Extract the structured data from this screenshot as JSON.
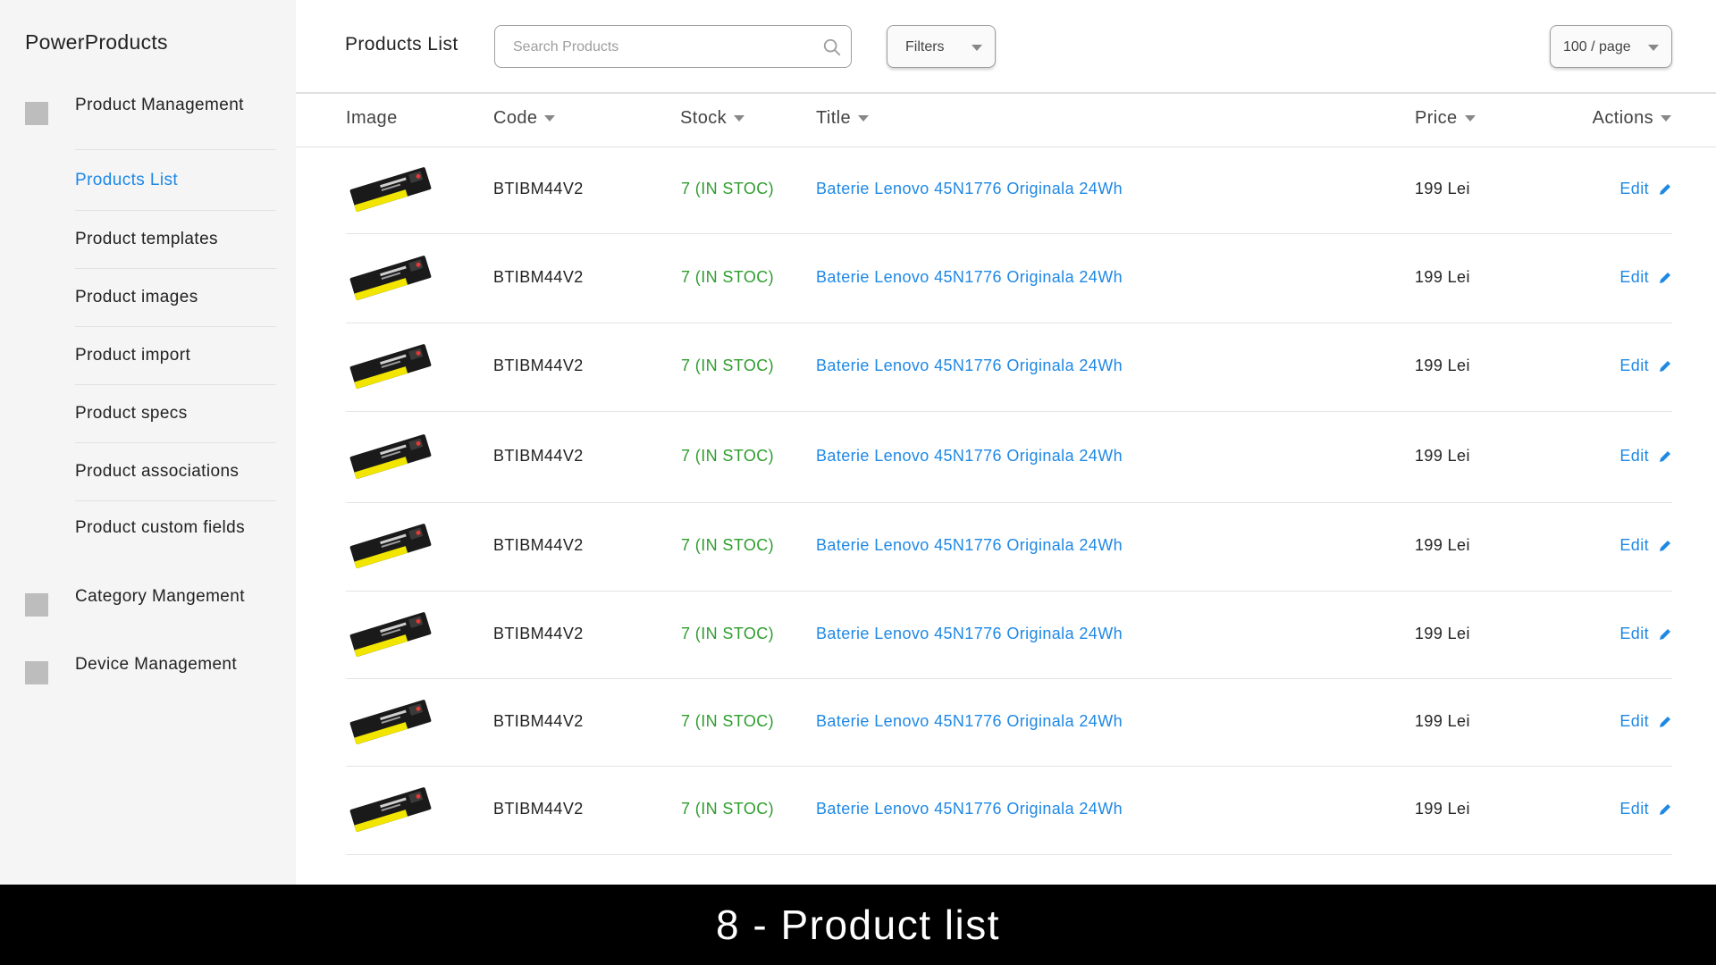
{
  "app": {
    "brand": "PowerProducts"
  },
  "sidebar": {
    "groups": [
      {
        "label": "Product Management"
      },
      {
        "label": "Category Mangement"
      },
      {
        "label": "Device Management"
      }
    ],
    "items": [
      {
        "label": "Products List",
        "active": true
      },
      {
        "label": "Product templates"
      },
      {
        "label": "Product images"
      },
      {
        "label": "Product import"
      },
      {
        "label": "Product specs"
      },
      {
        "label": "Product associations"
      },
      {
        "label": "Product custom fields"
      }
    ]
  },
  "header": {
    "title": "Products List",
    "search_placeholder": "Search Products",
    "filters_label": "Filters",
    "per_page_label": "100 / page"
  },
  "table": {
    "columns": [
      "Image",
      "Code",
      "Stock",
      "Title",
      "Price",
      "Actions"
    ],
    "rows": [
      {
        "code": "BTIBM44V2",
        "stock": "7 (IN STOC)",
        "title": "Baterie Lenovo 45N1776 Originala 24Wh",
        "price": "199 Lei",
        "action": "Edit"
      },
      {
        "code": "BTIBM44V2",
        "stock": "7 (IN STOC)",
        "title": "Baterie Lenovo 45N1776 Originala 24Wh",
        "price": "199 Lei",
        "action": "Edit"
      },
      {
        "code": "BTIBM44V2",
        "stock": "7 (IN STOC)",
        "title": "Baterie Lenovo 45N1776 Originala 24Wh",
        "price": "199 Lei",
        "action": "Edit"
      },
      {
        "code": "BTIBM44V2",
        "stock": "7 (IN STOC)",
        "title": "Baterie Lenovo 45N1776 Originala 24Wh",
        "price": "199 Lei",
        "action": "Edit"
      },
      {
        "code": "BTIBM44V2",
        "stock": "7 (IN STOC)",
        "title": "Baterie Lenovo 45N1776 Originala 24Wh",
        "price": "199 Lei",
        "action": "Edit"
      },
      {
        "code": "BTIBM44V2",
        "stock": "7 (IN STOC)",
        "title": "Baterie Lenovo 45N1776 Originala 24Wh",
        "price": "199 Lei",
        "action": "Edit"
      },
      {
        "code": "BTIBM44V2",
        "stock": "7 (IN STOC)",
        "title": "Baterie Lenovo 45N1776 Originala 24Wh",
        "price": "199 Lei",
        "action": "Edit"
      },
      {
        "code": "BTIBM44V2",
        "stock": "7 (IN STOC)",
        "title": "Baterie Lenovo 45N1776 Originala 24Wh",
        "price": "199 Lei",
        "action": "Edit"
      }
    ]
  },
  "caption": "8 - Product list",
  "icons": {
    "search": "search-icon",
    "caret": "caret-down-icon",
    "edit": "pencil-icon",
    "product_image": "battery-image",
    "group_icon": "square-icon"
  },
  "colors": {
    "accent": "#1e88e5",
    "stock": "#2e9d2e",
    "sidebar_bg": "#f5f5f5",
    "caption_bg": "#000000"
  }
}
